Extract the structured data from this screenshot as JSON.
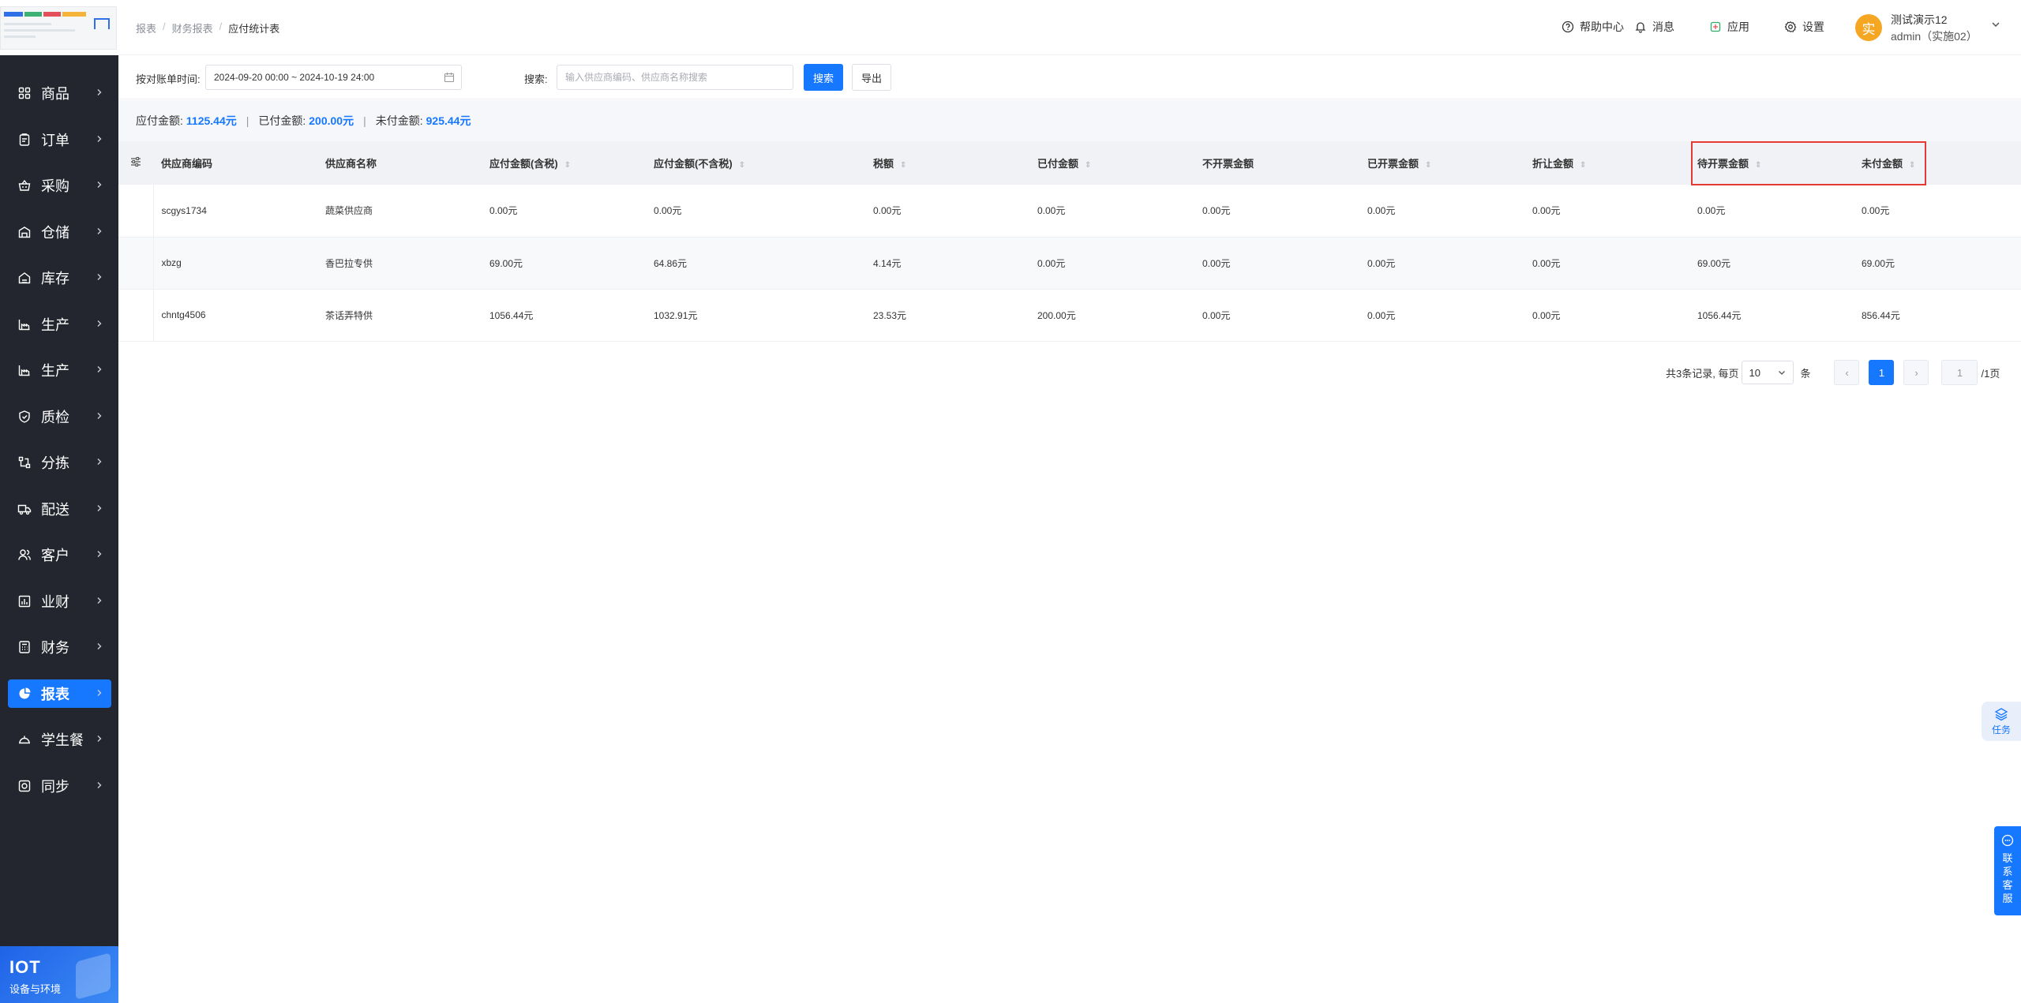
{
  "sidebar": {
    "items": [
      {
        "label": "商品",
        "icon": "grid-icon"
      },
      {
        "label": "订单",
        "icon": "clipboard-icon"
      },
      {
        "label": "采购",
        "icon": "basket-icon"
      },
      {
        "label": "仓储",
        "icon": "warehouse-icon"
      },
      {
        "label": "库存",
        "icon": "inventory-icon"
      },
      {
        "label": "生产",
        "icon": "factory-icon"
      },
      {
        "label": "生产",
        "icon": "factory-icon"
      },
      {
        "label": "质检",
        "icon": "shield-icon"
      },
      {
        "label": "分拣",
        "icon": "sort-icon"
      },
      {
        "label": "配送",
        "icon": "truck-icon"
      },
      {
        "label": "客户",
        "icon": "users-icon"
      },
      {
        "label": "业财",
        "icon": "bar-chart-icon"
      },
      {
        "label": "财务",
        "icon": "calculator-icon"
      },
      {
        "label": "报表",
        "icon": "pie-chart-icon",
        "active": true
      },
      {
        "label": "学生餐",
        "icon": "cloche-icon"
      },
      {
        "label": "同步",
        "icon": "sync-icon"
      }
    ],
    "banner": {
      "title": "IOT",
      "subtitle": "设备与环境"
    }
  },
  "header": {
    "breadcrumb": [
      "报表",
      "财务报表",
      "应付统计表"
    ],
    "help": "帮助中心",
    "messages": "消息",
    "apps": "应用",
    "settings": "设置",
    "avatar_char": "实",
    "user_name": "测试演示12",
    "user_role": "admin（实施02）"
  },
  "filters": {
    "date_label": "按对账单时间:",
    "date_range": "2024-09-20 00:00 ~ 2024-10-19 24:00",
    "search_label": "搜索:",
    "search_placeholder": "输入供应商编码、供应商名称搜索",
    "search_button": "搜索",
    "export_button": "导出"
  },
  "summary": {
    "payable_label": "应付金额:",
    "payable": "1125.44元",
    "paid_label": "已付金额:",
    "paid": "200.00元",
    "unpaid_label": "未付金额:",
    "unpaid": "925.44元"
  },
  "table": {
    "columns": [
      "供应商编码",
      "供应商名称",
      "应付金额(含税)",
      "应付金额(不含税)",
      "税额",
      "已付金额",
      "不开票金额",
      "已开票金额",
      "折让金额",
      "待开票金额",
      "未付金额"
    ],
    "rows": [
      [
        "scgys1734",
        "蔬菜供应商",
        "0.00元",
        "0.00元",
        "0.00元",
        "0.00元",
        "0.00元",
        "0.00元",
        "0.00元",
        "0.00元",
        "0.00元"
      ],
      [
        "xbzg",
        "香巴拉专供",
        "69.00元",
        "64.86元",
        "4.14元",
        "0.00元",
        "0.00元",
        "0.00元",
        "0.00元",
        "69.00元",
        "69.00元"
      ],
      [
        "chntg4506",
        "茶话弄特供",
        "1056.44元",
        "1032.91元",
        "23.53元",
        "200.00元",
        "0.00元",
        "0.00元",
        "0.00元",
        "1056.44元",
        "856.44元"
      ]
    ]
  },
  "pagination": {
    "total_text": "共3条记录, 每页",
    "page_size": "10",
    "unit": "条",
    "prev": "‹",
    "current": "1",
    "next": "›",
    "jump_value": "1",
    "total_pages": "/1页"
  },
  "floats": {
    "task": "任务",
    "contact": "联系客服"
  }
}
